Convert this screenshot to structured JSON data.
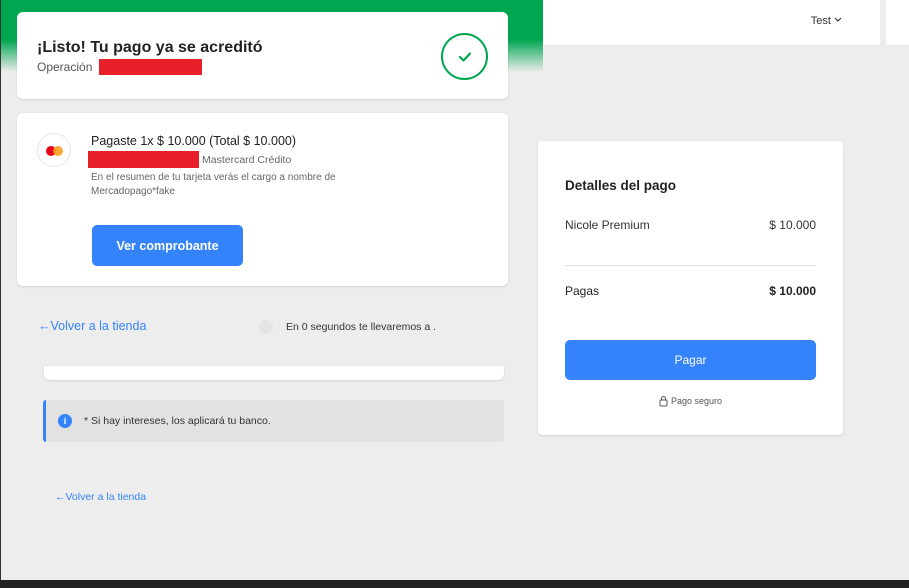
{
  "header": {
    "user_label": "Test"
  },
  "success_card": {
    "title": "¡Listo! Tu pago ya se acreditó",
    "operation_label": "Operación"
  },
  "payment_card": {
    "paid_line": "Pagaste 1x $ 10.000 (Total $ 10.000)",
    "card_type": "Mastercard Crédito",
    "statement_note": "En el resumen de tu tarjeta verás el cargo a nombre de Mercadopago*fake",
    "receipt_button": "Ver comprobante",
    "icon": "mastercard-icon"
  },
  "nav": {
    "back_link_top": "←Volver a la tienda",
    "redirect_text": "En 0 segundos te llevaremos a .",
    "back_link_bottom": "←Volver a la tienda"
  },
  "info_banner": {
    "text": "* Si hay intereses, los aplicará tu banco.",
    "icon": "info-icon"
  },
  "summary": {
    "title": "Detalles del pago",
    "item_label": "Nicole Premium",
    "item_value": "$ 10.000",
    "total_label": "Pagas",
    "total_value": "$ 10.000",
    "pay_button": "Pagar",
    "secure_label": "Pago seguro"
  },
  "colors": {
    "accent": "#3483fa",
    "success": "#00a650",
    "redaction": "#e8202a"
  }
}
